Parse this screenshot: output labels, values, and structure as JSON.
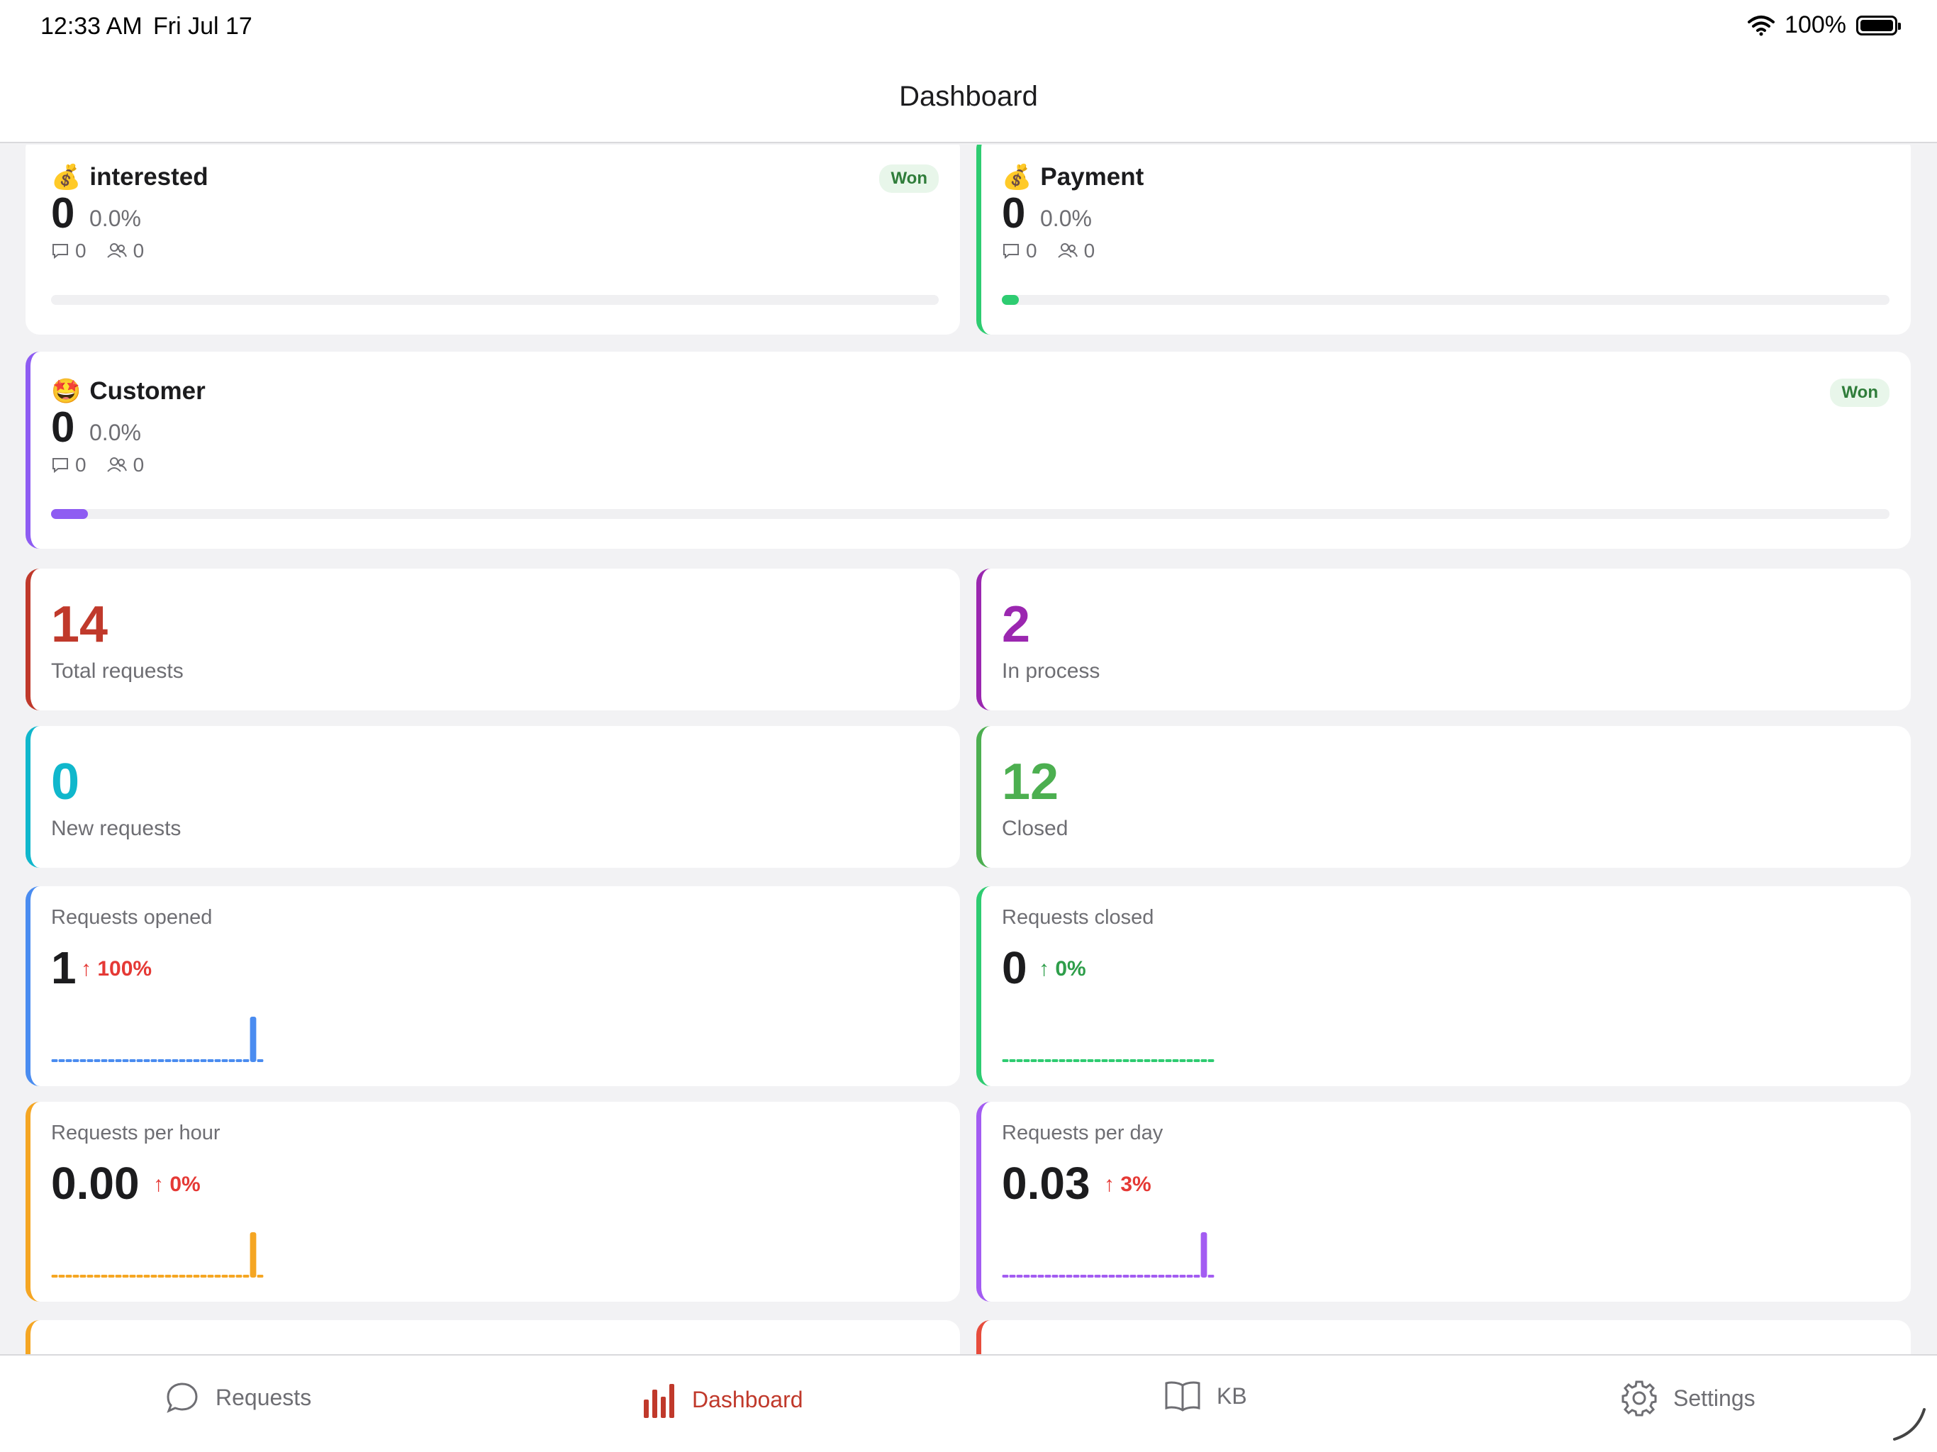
{
  "status": {
    "time": "12:33 AM",
    "date": "Fri Jul 17",
    "battery": "100%"
  },
  "nav": {
    "title": "Dashboard"
  },
  "stages": [
    {
      "emoji": "💰",
      "name": "interested",
      "count": "0",
      "pct": "0.0%",
      "comments": "0",
      "people": "0",
      "badge": "Won",
      "progress": 0,
      "color": "#ffffff"
    },
    {
      "emoji": "💰",
      "name": "Payment",
      "count": "0",
      "pct": "0.0%",
      "comments": "0",
      "people": "0",
      "badge": "",
      "progress": 0.01,
      "color": "#2ecc71"
    },
    {
      "emoji": "🤩",
      "name": "Customer",
      "count": "0",
      "pct": "0.0%",
      "comments": "0",
      "people": "0",
      "badge": "Won",
      "progress": 0.02,
      "color": "#8e5cf2"
    }
  ],
  "stats": [
    {
      "value": "14",
      "label": "Total requests",
      "color": "#c0392b"
    },
    {
      "value": "2",
      "label": "In process",
      "color": "#9b27b0"
    },
    {
      "value": "0",
      "label": "New requests",
      "color": "#10b7cc"
    },
    {
      "value": "12",
      "label": "Closed",
      "color": "#4caf50"
    }
  ],
  "metrics": [
    {
      "label": "Requests opened",
      "value": "1",
      "change": "↑ 100%",
      "change_color": "#e53935",
      "color": "#4a8cf0",
      "bars": [
        0,
        0,
        0,
        0,
        0,
        0,
        0,
        0,
        0,
        0,
        0,
        0,
        0,
        0,
        0,
        0,
        0,
        0,
        0,
        0,
        0,
        0,
        0,
        0,
        0,
        0,
        0,
        0,
        1,
        0
      ]
    },
    {
      "label": "Requests closed",
      "value": "0",
      "change": "↑ 0%",
      "change_color": "#2e9e4a",
      "color": "#2ecc71",
      "bars": [
        0,
        0,
        0,
        0,
        0,
        0,
        0,
        0,
        0,
        0,
        0,
        0,
        0,
        0,
        0,
        0,
        0,
        0,
        0,
        0,
        0,
        0,
        0,
        0,
        0,
        0,
        0,
        0,
        0,
        0
      ]
    },
    {
      "label": "Requests per hour",
      "value": "0.00",
      "change": "↑ 0%",
      "change_color": "#e53935",
      "color": "#f5a623",
      "bars": [
        0,
        0,
        0,
        0,
        0,
        0,
        0,
        0,
        0,
        0,
        0,
        0,
        0,
        0,
        0,
        0,
        0,
        0,
        0,
        0,
        0,
        0,
        0,
        0,
        0,
        0,
        0,
        0,
        1,
        0
      ]
    },
    {
      "label": "Requests per day",
      "value": "0.03",
      "change": "↑ 3%",
      "change_color": "#e53935",
      "color": "#a35cf2",
      "bars": [
        0,
        0,
        0,
        0,
        0,
        0,
        0,
        0,
        0,
        0,
        0,
        0,
        0,
        0,
        0,
        0,
        0,
        0,
        0,
        0,
        0,
        0,
        0,
        0,
        0,
        0,
        0,
        0,
        1,
        0
      ]
    }
  ],
  "partial_cards": [
    {
      "color": "#f5a623"
    },
    {
      "color": "#e74c3c"
    }
  ],
  "tabs": [
    {
      "label": "Requests",
      "icon": "chat-bubble-icon",
      "active": false
    },
    {
      "label": "Dashboard",
      "icon": "bar-chart-icon",
      "active": true
    },
    {
      "label": "KB",
      "icon": "book-icon",
      "active": false
    },
    {
      "label": "Settings",
      "icon": "gear-icon",
      "active": false
    }
  ],
  "accent_color": "#c0392b"
}
